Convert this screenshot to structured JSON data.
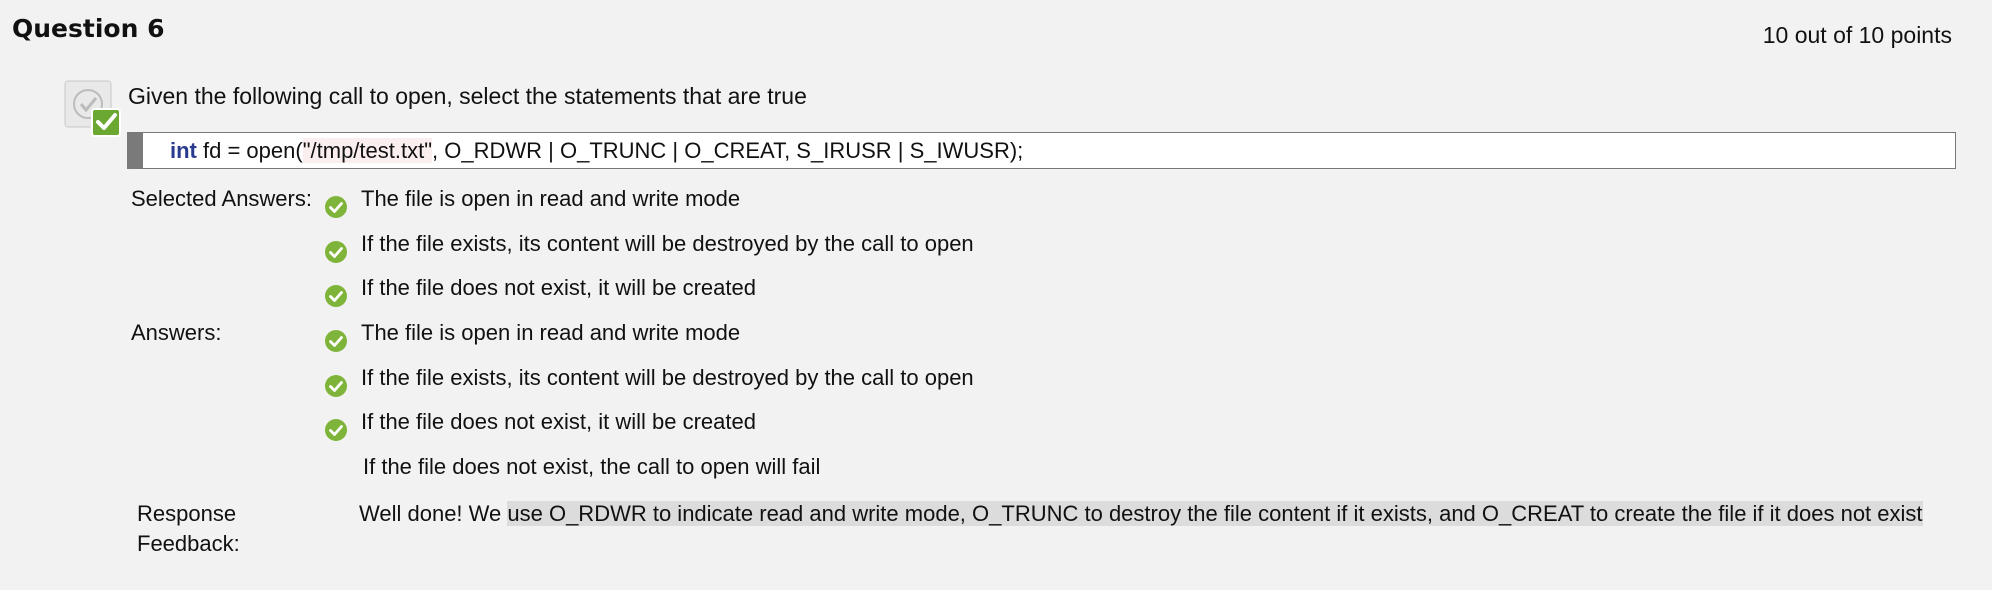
{
  "question": {
    "title": "Question 6",
    "points": "10 out of 10 points",
    "prompt": "Given the following call to open, select the statements that are true",
    "code": {
      "keyword": "int",
      "before_string": " fd = open(",
      "string": "\"/tmp/test.txt\"",
      "after_string": ", O_RDWR | O_TRUNC | O_CREAT, S_IRUSR | S_IWUSR);"
    }
  },
  "selected_answers": {
    "label": "Selected Answers:",
    "items": [
      "The file is open in read and write mode",
      "If the file exists, its content will be destroyed by the call to open",
      "If the file does not exist, it will be created"
    ]
  },
  "answers": {
    "label": "Answers:",
    "items": [
      "The file is open in read and write mode",
      "If the file exists, its content will be destroyed by the call to open",
      "If the file does not exist, it will be created",
      "If the file does not exist, the call to open will fail"
    ]
  },
  "feedback": {
    "label": "Response Feedback:",
    "prefix": "Well done! We ",
    "highlighted": "use O_RDWR to indicate read and write mode, O_TRUNC to destroy the file content if it exists, and O_CREAT to create the file if it does not exist"
  },
  "colors": {
    "background": "#f2f2f2",
    "check_green": "#7fb43a",
    "code_keyword": "#2a3b8f",
    "feedback_highlight": "#dcdcdc"
  },
  "icons": {
    "status": "graded-correct-icon",
    "answer_mark": "green-check-icon"
  }
}
